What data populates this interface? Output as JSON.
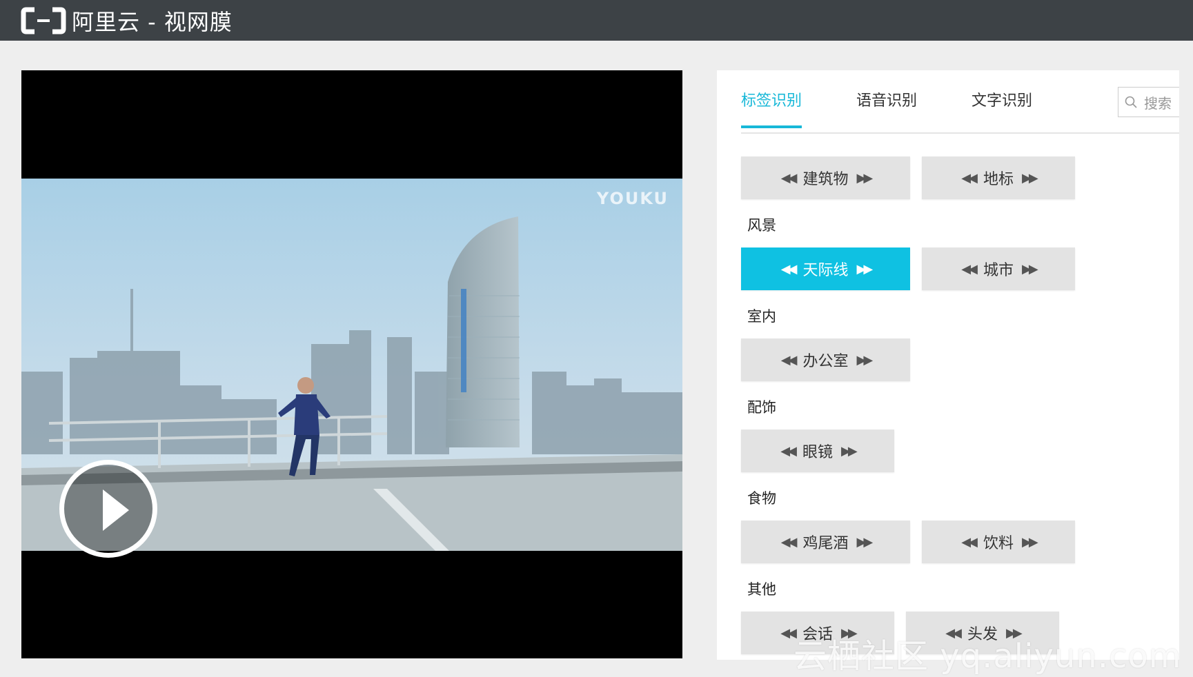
{
  "app": {
    "title": "阿里云 - 视网膜"
  },
  "video": {
    "watermark": "YOUKU"
  },
  "panel": {
    "tabs": [
      {
        "label": "标签识别"
      },
      {
        "label": "语音识别"
      },
      {
        "label": "文字识别"
      }
    ],
    "search_label": "搜索",
    "top_tags": [
      "建筑物",
      "地标"
    ],
    "groups": [
      {
        "name": "风景",
        "tags": [
          "天际线",
          "城市"
        ]
      },
      {
        "name": "室内",
        "tags": [
          "办公室"
        ]
      },
      {
        "name": "配饰",
        "tags": [
          "眼镜"
        ]
      },
      {
        "name": "食物",
        "tags": [
          "鸡尾酒",
          "饮料"
        ]
      },
      {
        "name": "其他",
        "tags": [
          "会话",
          "头发"
        ]
      }
    ]
  },
  "footer_watermark": "云栖社区 yq.aliyun.com",
  "colors": {
    "accent": "#0fc1e2",
    "topbar": "#3d4246",
    "tag_bg": "#e3e3e3"
  }
}
